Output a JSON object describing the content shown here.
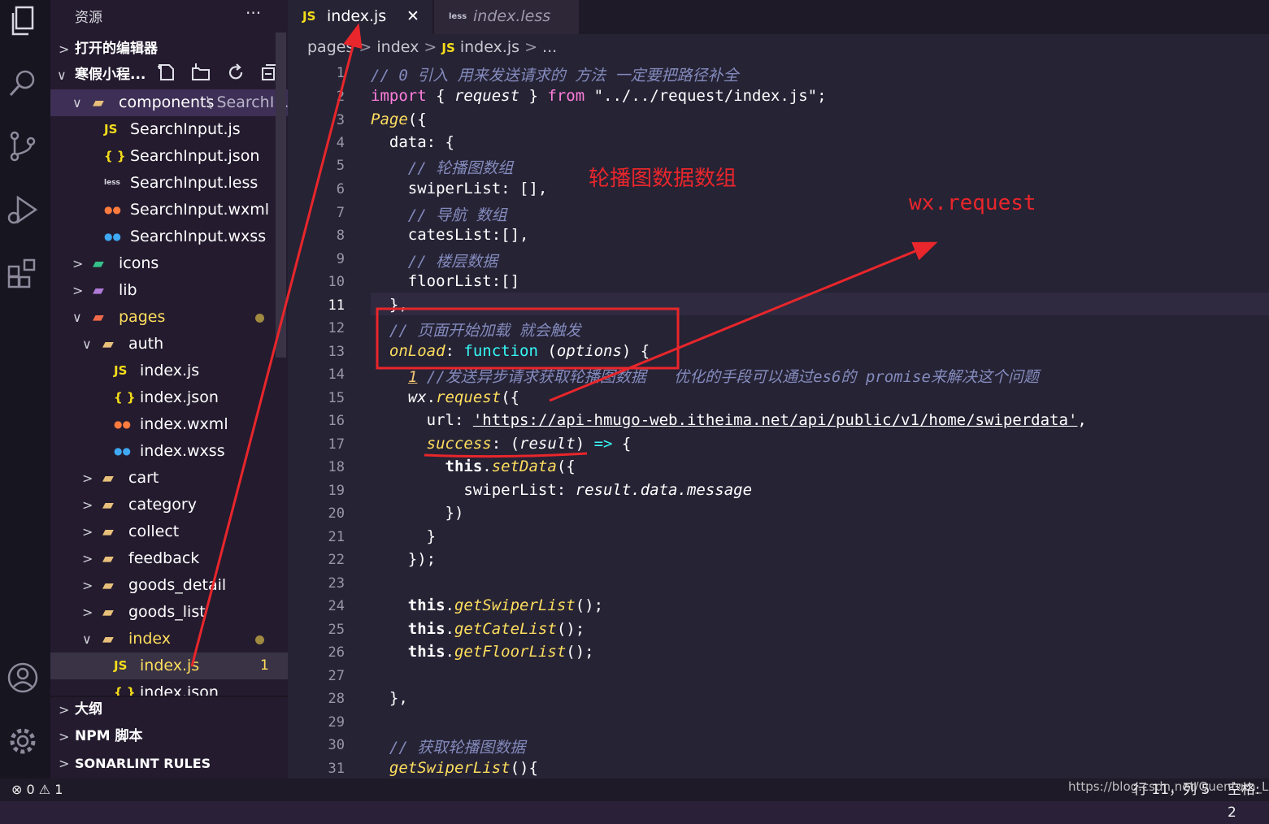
{
  "sidebar": {
    "title": "资源",
    "more": "···",
    "open_editors": "打开的编辑器",
    "project": "寒假小程...",
    "tree": [
      {
        "label": "components",
        "sub": "SearchI...",
        "kind": "folder",
        "chev": "∨",
        "depth": 0
      },
      {
        "label": "SearchInput.js",
        "kind": "js",
        "depth": 1
      },
      {
        "label": "SearchInput.json",
        "kind": "json",
        "depth": 1
      },
      {
        "label": "SearchInput.less",
        "kind": "less",
        "depth": 1
      },
      {
        "label": "SearchInput.wxml",
        "kind": "wxml",
        "depth": 1
      },
      {
        "label": "SearchInput.wxss",
        "kind": "wxss",
        "depth": 1
      },
      {
        "label": "icons",
        "kind": "folder-img",
        "chev": ">",
        "depth": 0
      },
      {
        "label": "lib",
        "kind": "folder-lib",
        "chev": ">",
        "depth": 0
      },
      {
        "label": "pages",
        "kind": "folder-pages",
        "chev": "∨",
        "depth": 0,
        "modified": true
      },
      {
        "label": "auth",
        "kind": "folder",
        "chev": "∨",
        "depth": 1
      },
      {
        "label": "index.js",
        "kind": "js",
        "depth": 2
      },
      {
        "label": "index.json",
        "kind": "json",
        "depth": 2
      },
      {
        "label": "index.wxml",
        "kind": "wxml",
        "depth": 2
      },
      {
        "label": "index.wxss",
        "kind": "wxss",
        "depth": 2
      },
      {
        "label": "cart",
        "kind": "folder",
        "chev": ">",
        "depth": 1
      },
      {
        "label": "category",
        "kind": "folder",
        "chev": ">",
        "depth": 1
      },
      {
        "label": "collect",
        "kind": "folder",
        "chev": ">",
        "depth": 1
      },
      {
        "label": "feedback",
        "kind": "folder",
        "chev": ">",
        "depth": 1
      },
      {
        "label": "goods_detail",
        "kind": "folder",
        "chev": ">",
        "depth": 1
      },
      {
        "label": "goods_list",
        "kind": "folder",
        "chev": ">",
        "depth": 1
      },
      {
        "label": "index",
        "kind": "folder",
        "chev": "∨",
        "depth": 1,
        "modified": true
      },
      {
        "label": "index.js",
        "kind": "js",
        "depth": 2,
        "count": "1",
        "selected": true
      },
      {
        "label": "index.json",
        "kind": "json",
        "depth": 2
      }
    ],
    "outline": "大纲",
    "npm": "NPM 脚本",
    "sonar": "SONARLINT RULES"
  },
  "tabs": [
    {
      "icon": "JS",
      "label": "index.js",
      "close": "✕"
    },
    {
      "icon": "less",
      "label": "index.less"
    }
  ],
  "breadcrumb": {
    "p1": "pages",
    "p2": "index",
    "icon": "JS",
    "p3": "index.js",
    "p4": "..."
  },
  "lines": [
    "1",
    "2",
    "3",
    "4",
    "5",
    "6",
    "7",
    "8",
    "9",
    "10",
    "11",
    "12",
    "13",
    "14",
    "15",
    "16",
    "17",
    "18",
    "19",
    "20",
    "21",
    "22",
    "23",
    "24",
    "25",
    "26",
    "27",
    "28",
    "29",
    "30",
    "31"
  ],
  "code": {
    "l1": "// 0 引入 用来发送请求的 方法 一定要把路径补全",
    "l2a": "import",
    "l2b": " { ",
    "l2c": "request",
    "l2d": " } ",
    "l2e": "from",
    "l2f": " \"../../request/index.js\";",
    "l3a": "Page",
    "l3b": "({",
    "l4": "  data: {",
    "l5": "    // 轮播图数组",
    "l6": "    swiperList: [],",
    "l7": "    // 导航 数组",
    "l8": "    catesList:[],",
    "l9": "    // 楼层数据",
    "l10": "    floorList:[]",
    "l11": "  },",
    "l12": "  // 页面开始加载 就会触发",
    "l13a": "  onLoad",
    "l13b": ": ",
    "l13c": "function",
    "l13d": " (",
    "l13e": "options",
    "l13f": ") {",
    "l14a": "1",
    "l14b": " //发送异步请求获取轮播图数据   优化的手段可以通过es6的 promise来解决这个问题",
    "l15a": "    ",
    "l15b": "wx",
    "l15c": ".",
    "l15d": "request",
    "l15e": "({",
    "l16a": "      url: ",
    "l16b": "'https://api-hmugo-web.itheima.net/api/public/v1/home/swiperdata'",
    "l16c": ",",
    "l17a": "      ",
    "l17b": "success",
    "l17c": ": (",
    "l17d": "result",
    "l17e": ") ",
    "l17f": "=>",
    "l17g": " {",
    "l18a": "        ",
    "l18b": "this",
    "l18c": ".",
    "l18d": "setData",
    "l18e": "({",
    "l19a": "          swiperList: ",
    "l19b": "result.data.message",
    "l20": "        })",
    "l21": "      }",
    "l22": "    });",
    "l24a": "    ",
    "l24b": "this",
    "l24c": ".",
    "l24d": "getSwiperList",
    "l24e": "();",
    "l25a": "    ",
    "l25b": "this",
    "l25c": ".",
    "l25d": "getCateList",
    "l25e": "();",
    "l26a": "    ",
    "l26b": "this",
    "l26c": ".",
    "l26d": "getFloorList",
    "l26e": "();",
    "l28": "  },",
    "l30": "  // 获取轮播图数据",
    "l31a": "  ",
    "l31b": "getSwiperList",
    "l31c": "(){"
  },
  "annotations": {
    "swiper_note": "轮播图数据数组",
    "request_note": "wx.request",
    "red": "#e8262b"
  },
  "status": {
    "errors": "0",
    "warnings": "1",
    "position": "行 11，列 5",
    "spaces": "空格: 2",
    "watermark": "https://blog.csdn.net/Quentum_Liu"
  },
  "colors": {
    "background": "#262335",
    "sidebar": "#241b2f",
    "activity": "#171520",
    "keyword": "#fede5d",
    "comment": "#848bbd",
    "string": "#ff8b39",
    "function": "#36f9f6",
    "pink": "#ff7edb"
  }
}
